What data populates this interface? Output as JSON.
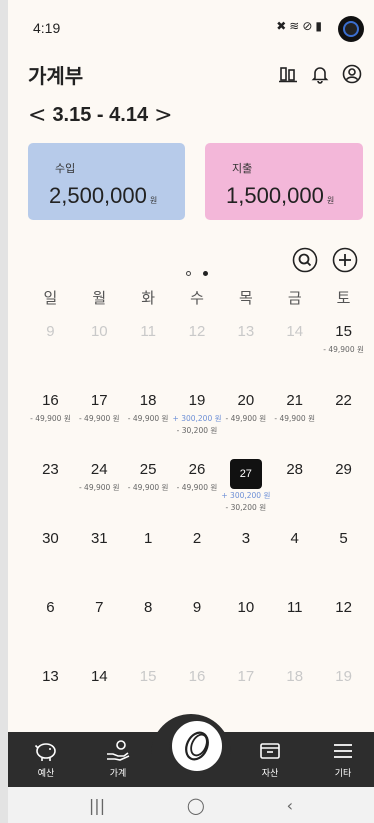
{
  "status": {
    "time": "4:19"
  },
  "header": {
    "title": "가계부"
  },
  "period": {
    "prev": "<",
    "range": "3.15 - 4.14",
    "next": ">"
  },
  "summary": {
    "unit": "원",
    "income": {
      "label": "수입",
      "amount": "2,500,000"
    },
    "expense": {
      "label": "지출",
      "amount": "1,500,000"
    }
  },
  "calendar": {
    "weekdays": [
      "일",
      "월",
      "화",
      "수",
      "목",
      "금",
      "토"
    ],
    "weeks": [
      [
        {
          "day": "9",
          "other": true
        },
        {
          "day": "10",
          "other": true
        },
        {
          "day": "11",
          "other": true
        },
        {
          "day": "12",
          "other": true
        },
        {
          "day": "13",
          "other": true
        },
        {
          "day": "14",
          "other": true
        },
        {
          "day": "15",
          "expense": "- 49,900 원"
        }
      ],
      [
        {
          "day": "16",
          "expense": "- 49,900 원"
        },
        {
          "day": "17",
          "expense": "- 49,900 원"
        },
        {
          "day": "18",
          "expense": "- 49,900 원"
        },
        {
          "day": "19",
          "income": "+ 300,200 원",
          "expense": "- 30,200 원"
        },
        {
          "day": "20",
          "expense": "- 49,900 원"
        },
        {
          "day": "21",
          "expense": "- 49,900 원"
        },
        {
          "day": "22"
        }
      ],
      [
        {
          "day": "23"
        },
        {
          "day": "24",
          "expense": "- 49,900 원"
        },
        {
          "day": "25",
          "expense": "- 49,900 원"
        },
        {
          "day": "26",
          "expense": "- 49,900 원"
        },
        {
          "day": "27",
          "today": true,
          "income": "+ 300,200 원",
          "expense": "- 30,200 원"
        },
        {
          "day": "28"
        },
        {
          "day": "29"
        }
      ],
      [
        {
          "day": "30"
        },
        {
          "day": "31"
        },
        {
          "day": "1"
        },
        {
          "day": "2"
        },
        {
          "day": "3"
        },
        {
          "day": "4"
        },
        {
          "day": "5"
        }
      ],
      [
        {
          "day": "6"
        },
        {
          "day": "7"
        },
        {
          "day": "8"
        },
        {
          "day": "9"
        },
        {
          "day": "10"
        },
        {
          "day": "11"
        },
        {
          "day": "12"
        }
      ],
      [
        {
          "day": "13"
        },
        {
          "day": "14"
        },
        {
          "day": "15",
          "other": true
        },
        {
          "day": "16",
          "other": true
        },
        {
          "day": "17",
          "other": true
        },
        {
          "day": "18",
          "other": true
        },
        {
          "day": "19",
          "other": true
        }
      ]
    ]
  },
  "nav": {
    "items": [
      "예산",
      "가계",
      "자산",
      "기타"
    ]
  },
  "colors": {
    "income_card": "#b7cbea",
    "expense_card": "#f3b7d9",
    "income_text": "#6d8fd6",
    "nav_bg": "#2d2d2d"
  }
}
